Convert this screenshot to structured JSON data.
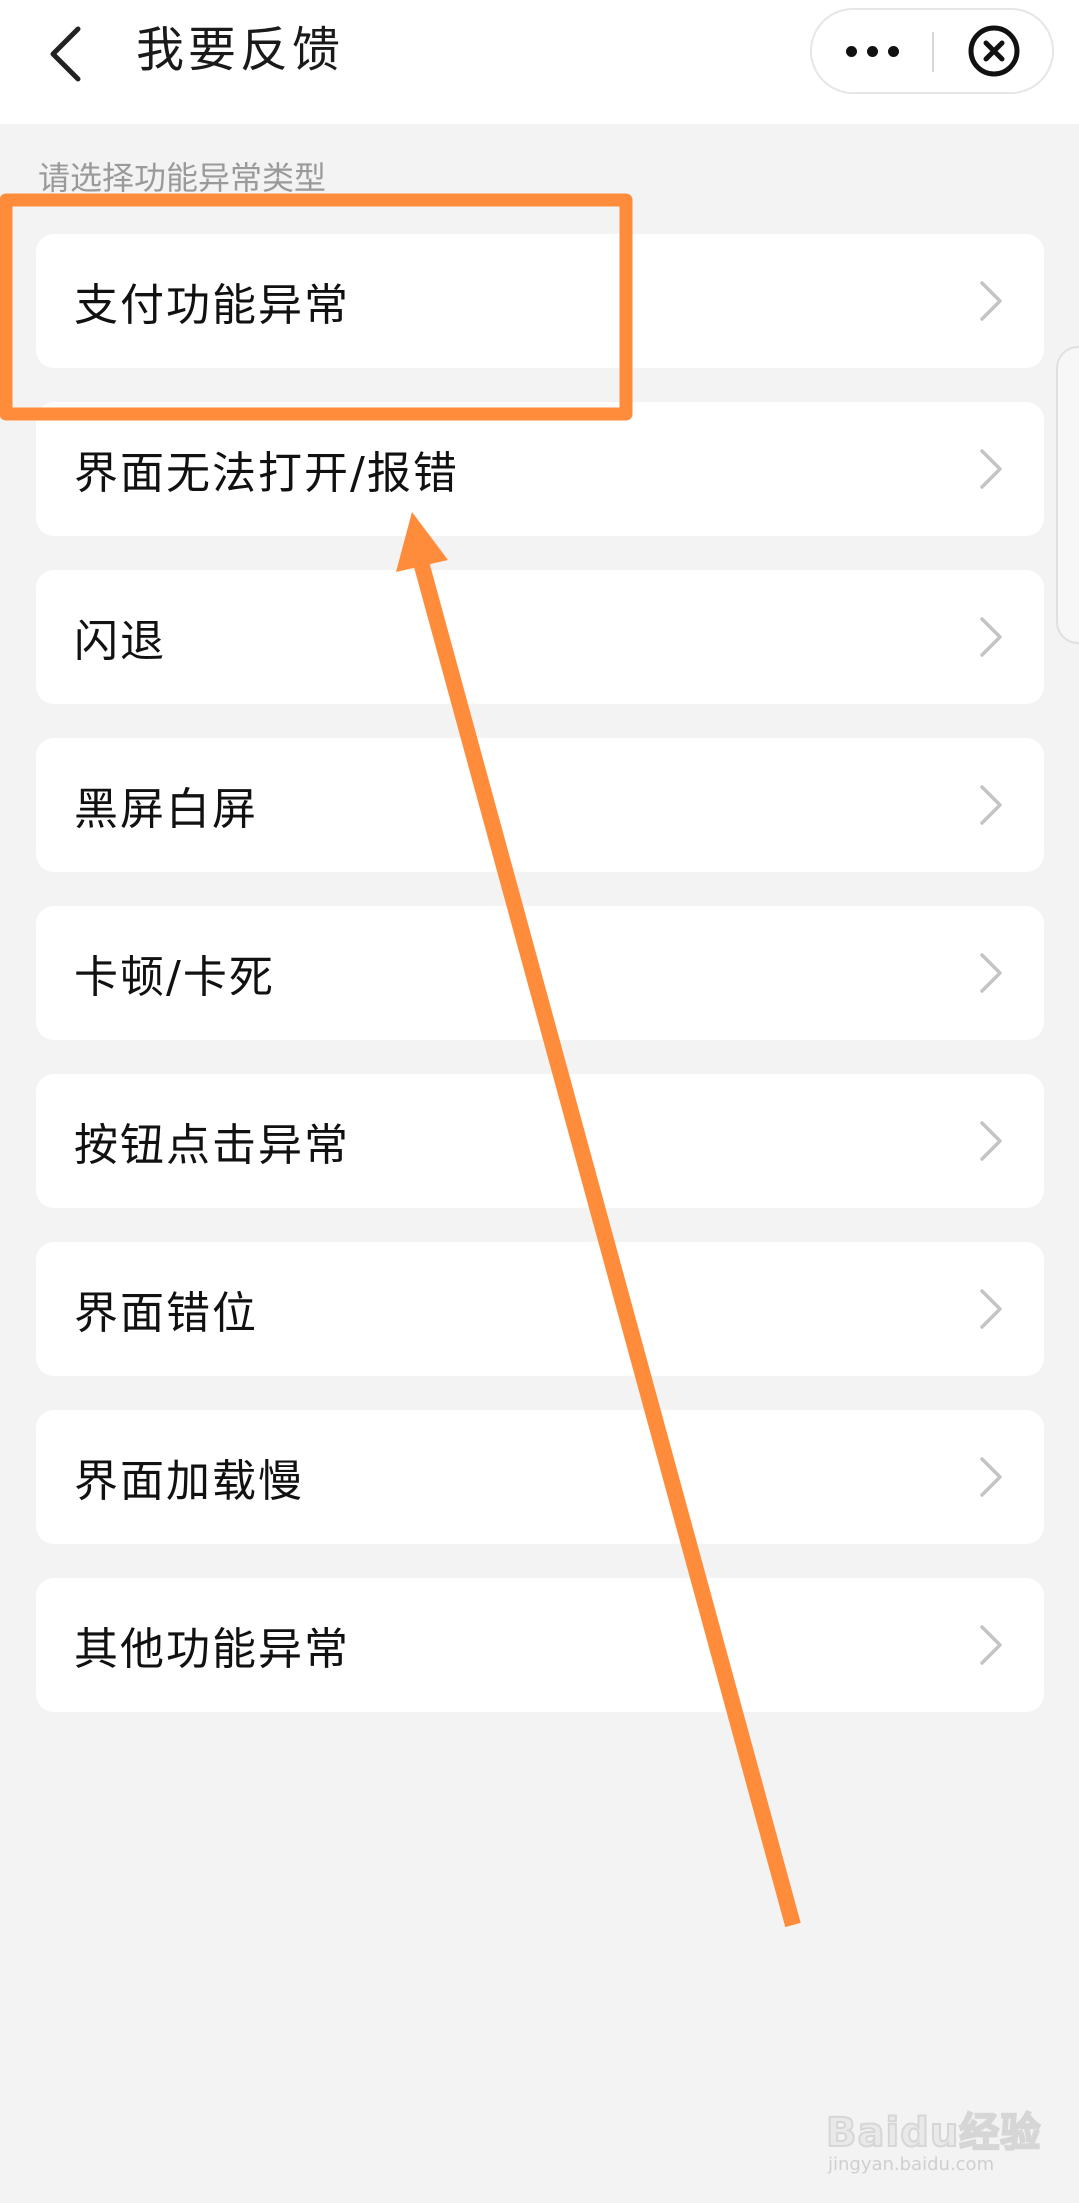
{
  "header": {
    "title": "我要反馈",
    "back_icon": "chevron-left-icon",
    "more_icon": "more-dots-icon",
    "close_icon": "close-circle-icon"
  },
  "section_label": "请选择功能异常类型",
  "options": [
    {
      "label": "支付功能异常"
    },
    {
      "label": "界面无法打开/报错"
    },
    {
      "label": "闪退"
    },
    {
      "label": "黑屏白屏"
    },
    {
      "label": "卡顿/卡死"
    },
    {
      "label": "按钮点击异常"
    },
    {
      "label": "界面错位"
    },
    {
      "label": "界面加载慢"
    },
    {
      "label": "其他功能异常"
    }
  ],
  "annotation": {
    "highlight_color": "#ff8c3a",
    "arrow_color": "#ff8c3a"
  },
  "watermark": {
    "brand": "Baidu经验",
    "url": "jingyan.baidu.com"
  }
}
